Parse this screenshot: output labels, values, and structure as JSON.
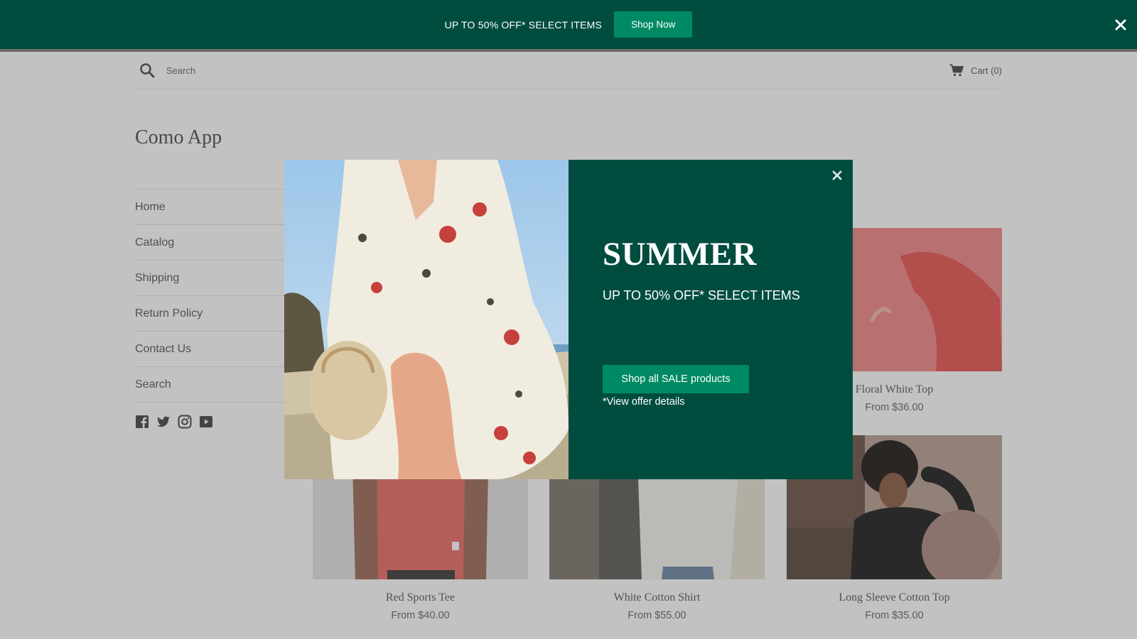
{
  "announcement": {
    "text": "UP TO 50% OFF* SELECT ITEMS",
    "button_label": "Shop Now",
    "bg_color": "#004d3f",
    "button_color": "#008a64"
  },
  "header": {
    "search_placeholder": "Search",
    "cart_label": "Cart (0)"
  },
  "store": {
    "logo": "Como App"
  },
  "nav": {
    "items": [
      {
        "label": "Home"
      },
      {
        "label": "Catalog"
      },
      {
        "label": "Shipping"
      },
      {
        "label": "Return Policy"
      },
      {
        "label": "Contact Us"
      },
      {
        "label": "Search"
      }
    ]
  },
  "socials": [
    "facebook-icon",
    "twitter-icon",
    "instagram-icon",
    "youtube-icon"
  ],
  "products": [
    {
      "name": "Floral White Top",
      "price": "From $36.00"
    },
    {
      "name": "Red Sports Tee",
      "price": "From $40.00"
    },
    {
      "name": "White Cotton Shirt",
      "price": "From $55.00"
    },
    {
      "name": "Long Sleeve Cotton Top",
      "price": "From $35.00"
    }
  ],
  "popup": {
    "title": "SUMMER",
    "subtitle": "UP TO 50% OFF* SELECT ITEMS",
    "button_label": "Shop all SALE products",
    "details_link": "*View offer details",
    "panel_color": "#004d3f",
    "button_color": "#008a64"
  }
}
